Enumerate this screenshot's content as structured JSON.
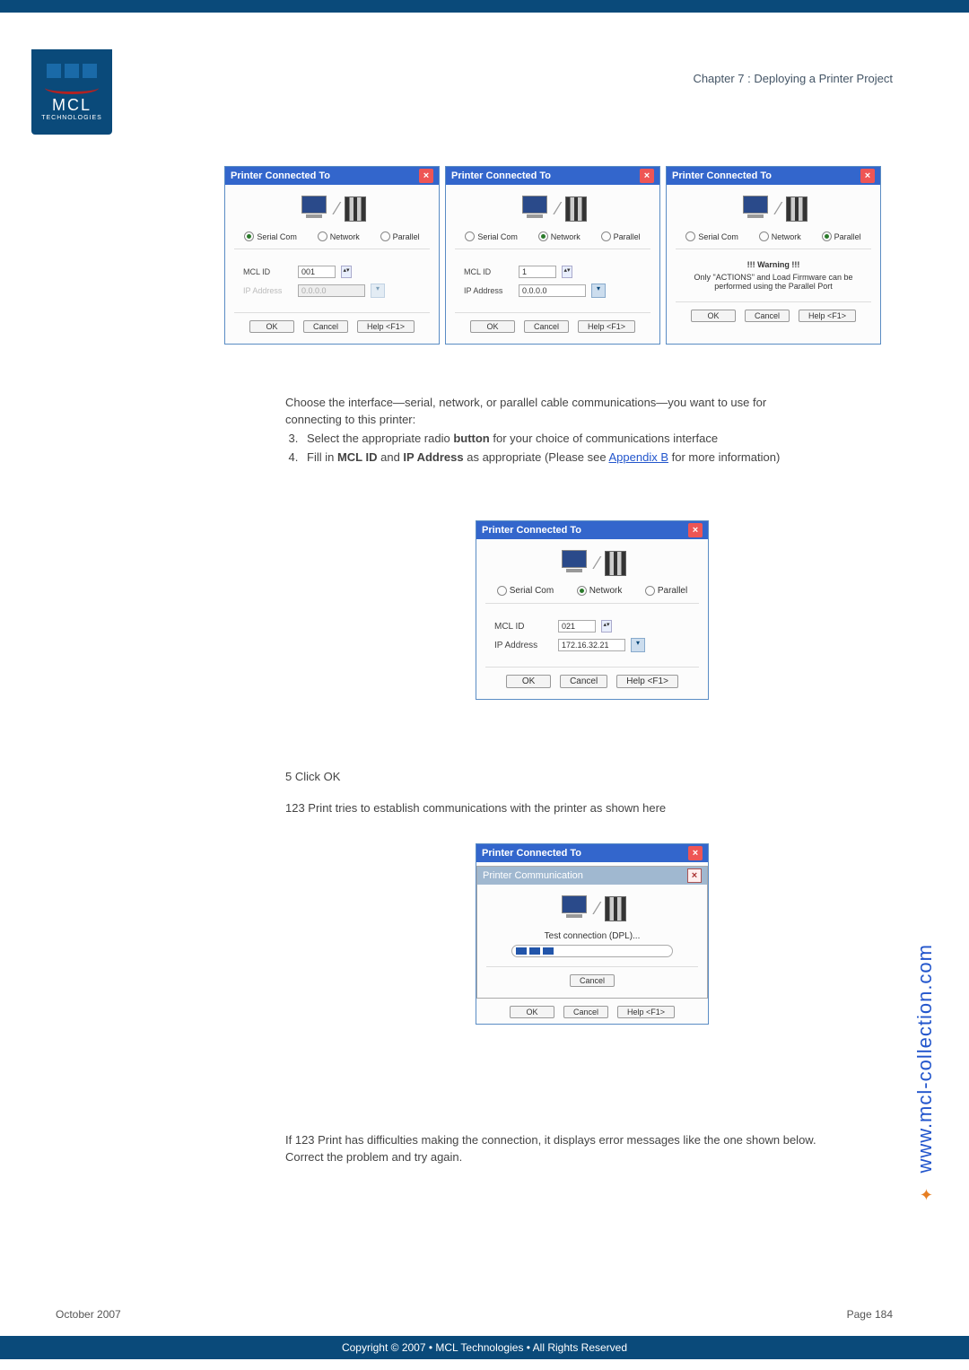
{
  "header": {
    "chapter": "Chapter 7 : Deploying a Printer Project"
  },
  "logo": {
    "main": "MCL",
    "sub": "TECHNOLOGIES"
  },
  "dialogs": {
    "title": "Printer Connected To",
    "radios": {
      "serial": "Serial Com",
      "network": "Network",
      "parallel": "Parallel"
    },
    "fields": {
      "mcl_id": "MCL ID",
      "ip_addr": "IP Address"
    },
    "d1": {
      "mcl_id_val": "001",
      "ip_val": "0.0.0.0"
    },
    "d2": {
      "mcl_id_val": "1",
      "ip_val": "0.0.0.0"
    },
    "d3": {
      "warn_title": "!!! Warning !!!",
      "warn_body": "Only \"ACTIONS\" and Load Firmware can be performed using the Parallel Port"
    },
    "d4": {
      "mcl_id_val": "021",
      "ip_val": "172.16.32.21"
    },
    "comm_title": "Printer Communication",
    "test_line": "Test connection (DPL)...",
    "buttons": {
      "ok": "OK",
      "cancel": "Cancel",
      "help": "Help <F1>"
    }
  },
  "body": {
    "p1a": "Choose the interface—serial,  network, or parallel cable communications—you want to use for connecting to this printer:",
    "li3a": "Select the appropriate radio ",
    "li3b": "button",
    "li3c": " for your choice of communications interface",
    "li4a": "Fill in ",
    "li4b": "MCL ID",
    "li4c": " and ",
    "li4d": "IP Address",
    "li4e": " as appropriate (Please see ",
    "li4link": "Appendix B",
    "li4f": " for more information)",
    "li5": "5    Click OK",
    "p2": "123 Print tries to establish communications with the printer as shown here",
    "p3": "If 123 Print has difficulties making the connection, it displays error messages like the one shown below. Correct the problem and try again."
  },
  "side": {
    "url": "www.mcl-collection.com"
  },
  "footer": {
    "date": "October 2007",
    "page": "Page 184",
    "copyright": "Copyright © 2007 • MCL Technologies • All Rights Reserved"
  }
}
